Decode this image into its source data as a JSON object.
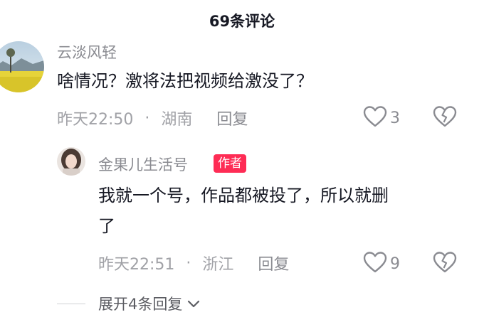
{
  "header": {
    "title": "69条评论"
  },
  "comment": {
    "username": "云淡风轻",
    "text": "啥情况？激将法把视频给激没了？",
    "time": "昨天22:50",
    "separator": "·",
    "location": "湖南",
    "reply_label": "回复",
    "like_count": "3"
  },
  "reply": {
    "username": "金果儿生活号",
    "author_badge": "作者",
    "text_line1": "我就一个号，作品都被投了，所以就删",
    "text_line2": "了",
    "time": "昨天22:51",
    "separator": "·",
    "location": "浙江",
    "reply_label": "回复",
    "like_count": "9"
  },
  "expand": {
    "label": "展开4条回复"
  },
  "colors": {
    "accent": "#fe2c55",
    "muted": "#a0a1a6",
    "text": "#161823"
  }
}
